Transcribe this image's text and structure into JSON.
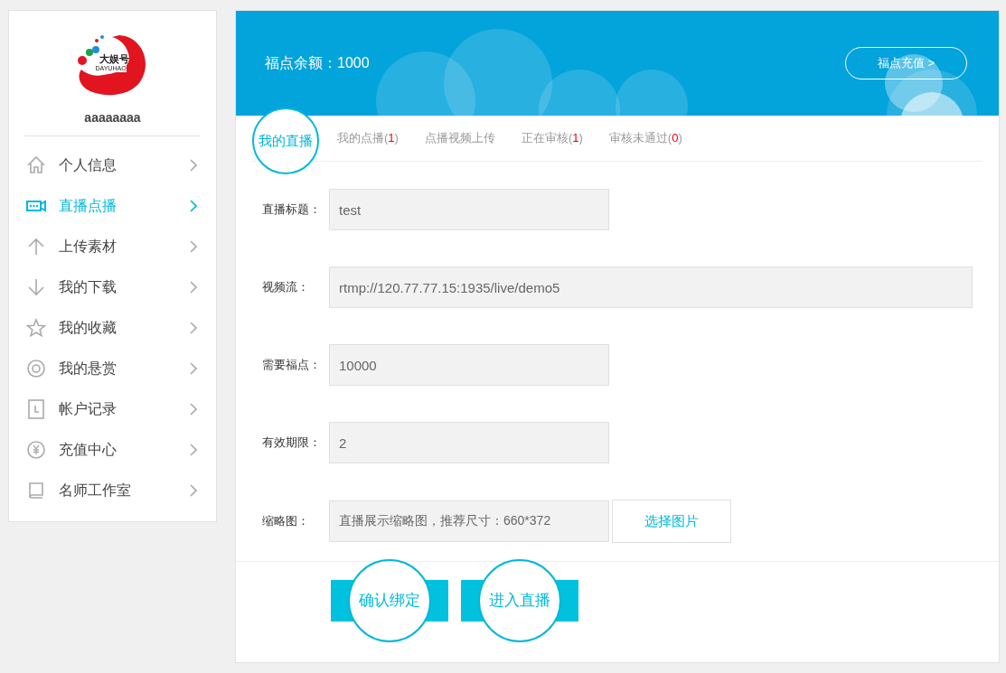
{
  "sidebar": {
    "logo": {
      "title": "大娱号",
      "subtitle": "DAYUHAO"
    },
    "username": "aaaaaaaa",
    "items": [
      {
        "label": "个人信息",
        "selected": false
      },
      {
        "label": "直播点播",
        "selected": true
      },
      {
        "label": "上传素材",
        "selected": false
      },
      {
        "label": "我的下载",
        "selected": false
      },
      {
        "label": "我的收藏",
        "selected": false
      },
      {
        "label": "我的悬赏",
        "selected": false
      },
      {
        "label": "帐户记录",
        "selected": false
      },
      {
        "label": "充值中心",
        "selected": false
      },
      {
        "label": "名师工作室",
        "selected": false
      }
    ]
  },
  "banner": {
    "balance": "福点余额：1000",
    "recharge_button": "福点充值 >"
  },
  "tabs": [
    {
      "label": "我的直播",
      "selected": true
    },
    {
      "label": "我的点播(",
      "count": "1",
      "suffix": ")",
      "selected": false
    },
    {
      "label": "点播视频上传",
      "selected": false
    },
    {
      "label": "正在审核(",
      "count": "1",
      "suffix": ")",
      "selected": false
    },
    {
      "label": "审核未通过(",
      "count": "0",
      "suffix": ")",
      "selected": false
    }
  ],
  "form": [
    {
      "label": "直播标题：",
      "value": "test",
      "kind": "short"
    },
    {
      "label": "视频流：",
      "value": "rtmp://120.77.77.15:1935/live/demo5",
      "kind": "wide"
    },
    {
      "label": "需要福点：",
      "value": "10000",
      "kind": "short"
    },
    {
      "label": "有效期限：",
      "value": "2",
      "kind": "short"
    },
    {
      "label": "缩略图：",
      "value": "直播展示缩略图，推荐尺寸：660*372",
      "kind": "file",
      "button": "选择图片"
    }
  ],
  "actions": [
    "确认绑定",
    "进入直播"
  ]
}
